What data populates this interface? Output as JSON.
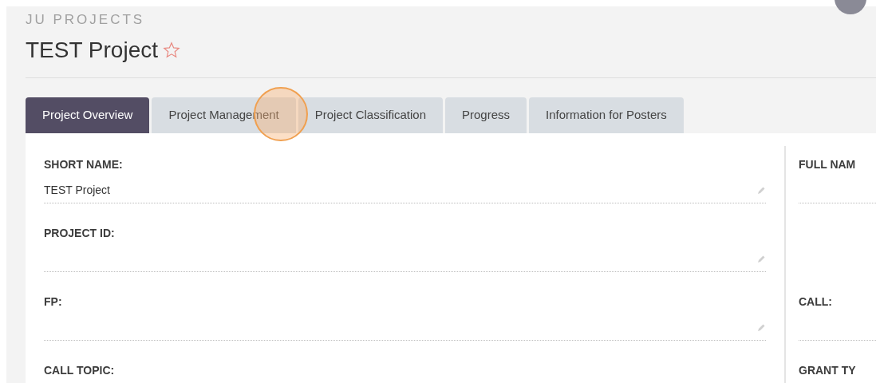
{
  "header": {
    "module": "JU PROJECTS",
    "title": "TEST Project",
    "favorite": false
  },
  "tabs": [
    {
      "label": "Project Overview",
      "selected": true
    },
    {
      "label": "Project Management",
      "selected": false
    },
    {
      "label": "Project Classification",
      "selected": false
    },
    {
      "label": "Progress",
      "selected": false
    },
    {
      "label": "Information for Posters",
      "selected": false
    }
  ],
  "rows": [
    {
      "left": {
        "label": "SHORT NAME:",
        "value": "TEST Project"
      },
      "right": {
        "label": "FULL NAM"
      }
    },
    {
      "left": {
        "label": "PROJECT ID:"
      }
    },
    {
      "left": {
        "label": "FP:"
      },
      "right": {
        "label": "CALL:"
      }
    },
    {
      "left": {
        "label": "CALL TOPIC:"
      },
      "right": {
        "label": "GRANT TY"
      }
    }
  ]
}
